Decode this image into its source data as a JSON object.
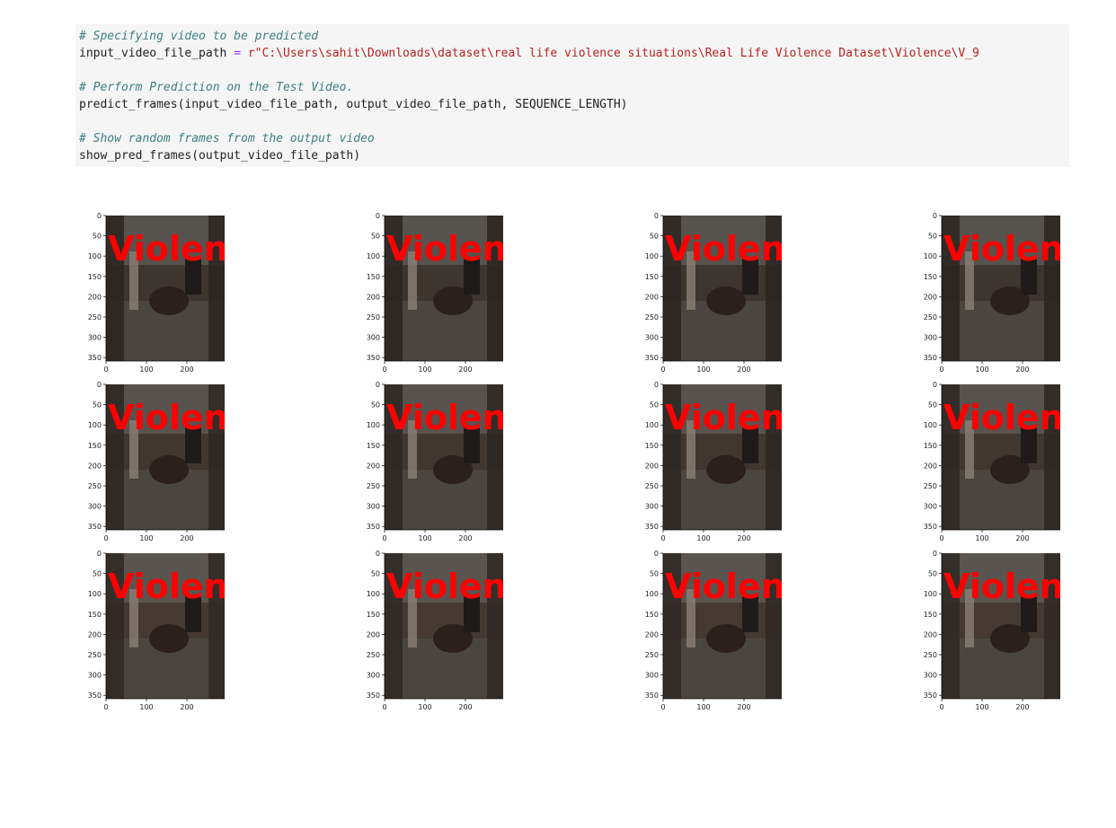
{
  "code_cell": {
    "lines": [
      {
        "type": "comment",
        "text": "# Specifying video to be predicted"
      },
      {
        "type": "assign",
        "var": "input_video_file_path",
        "op": " = ",
        "str": "r\"C:\\Users\\sahit\\Downloads\\dataset\\real life violence situations\\Real Life Violence Dataset\\Violence\\V_9"
      },
      {
        "type": "blank"
      },
      {
        "type": "comment",
        "text": "# Perform Prediction on the Test Video."
      },
      {
        "type": "code",
        "text": "predict_frames(input_video_file_path, output_video_file_path, SEQUENCE_LENGTH)"
      },
      {
        "type": "blank"
      },
      {
        "type": "comment",
        "text": "# Show random frames from the output video"
      },
      {
        "type": "code",
        "text": "show_pred_frames(output_video_file_path)"
      }
    ]
  },
  "output": {
    "frame_label": "Violence",
    "frame_label_color": "#ff0000",
    "y_ticks": [
      "0",
      "50",
      "100",
      "150",
      "200",
      "250",
      "300",
      "350"
    ],
    "x_ticks": [
      "0",
      "100",
      "200"
    ],
    "rows": 3,
    "cols": 4
  }
}
